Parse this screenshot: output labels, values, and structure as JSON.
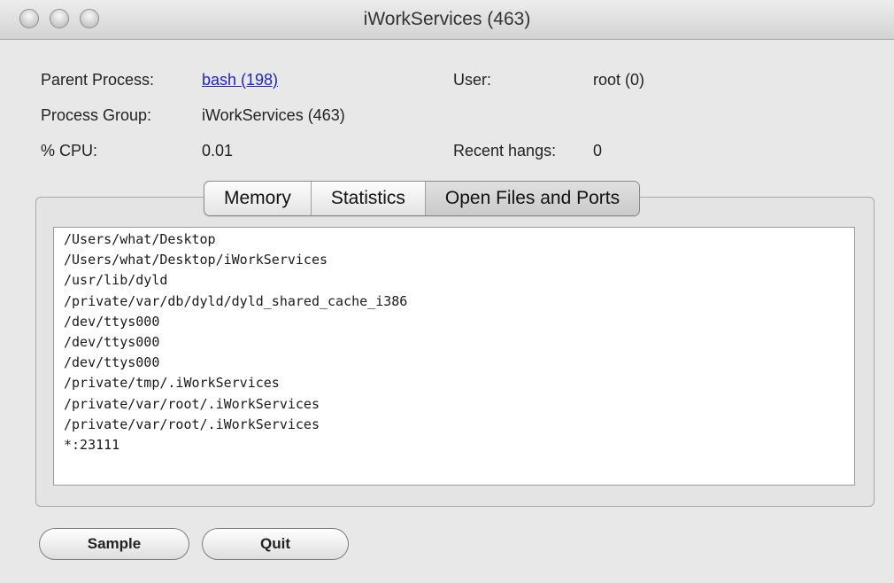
{
  "window": {
    "title": "iWorkServices (463)"
  },
  "info": {
    "parent_process_label": "Parent Process:",
    "parent_process_value": "bash (198)",
    "user_label": "User:",
    "user_value": "root (0)",
    "process_group_label": "Process Group:",
    "process_group_value": "iWorkServices (463)",
    "cpu_label": "% CPU:",
    "cpu_value": "0.01",
    "recent_hangs_label": "Recent hangs:",
    "recent_hangs_value": "0"
  },
  "tabs": [
    {
      "label": "Memory"
    },
    {
      "label": "Statistics"
    },
    {
      "label": "Open Files and Ports",
      "active": true
    }
  ],
  "open_files": [
    "/Users/what/Desktop",
    "/Users/what/Desktop/iWorkServices",
    "/usr/lib/dyld",
    "/private/var/db/dyld/dyld_shared_cache_i386",
    "/dev/ttys000",
    "/dev/ttys000",
    "/dev/ttys000",
    "/private/tmp/.iWorkServices",
    "/private/var/root/.iWorkServices",
    "/private/var/root/.iWorkServices",
    "*:23111"
  ],
  "buttons": {
    "sample_label": "Sample",
    "quit_label": "Quit"
  }
}
